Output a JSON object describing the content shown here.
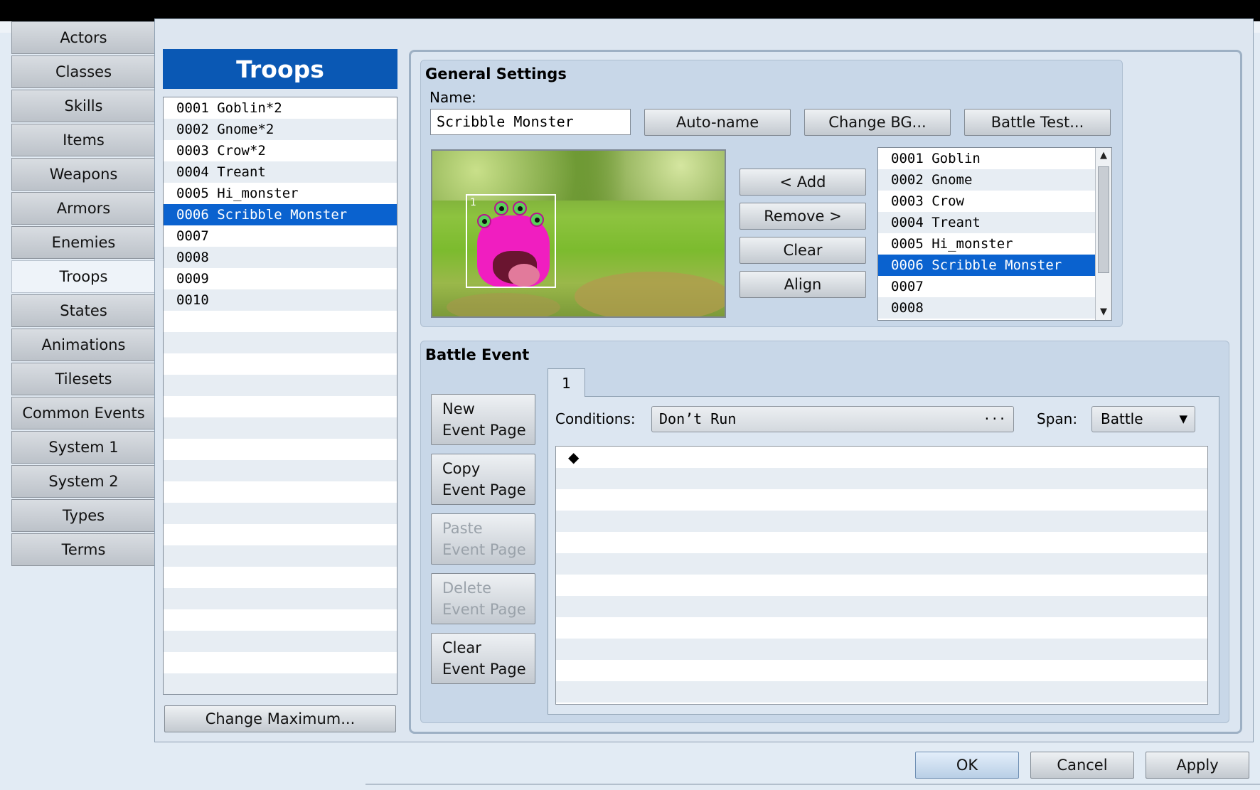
{
  "sidebar": {
    "tabs": [
      "Actors",
      "Classes",
      "Skills",
      "Items",
      "Weapons",
      "Armors",
      "Enemies",
      "Troops",
      "States",
      "Animations",
      "Tilesets",
      "Common Events",
      "System 1",
      "System 2",
      "Types",
      "Terms"
    ],
    "active": "Troops"
  },
  "troops": {
    "header": "Troops",
    "items": [
      "0001 Goblin*2",
      "0002 Gnome*2",
      "0003 Crow*2",
      "0004 Treant",
      "0005 Hi_monster",
      "0006 Scribble Monster",
      "0007",
      "0008",
      "0009",
      "0010"
    ],
    "selected_index": 5,
    "change_max_label": "Change Maximum..."
  },
  "general": {
    "title": "General Settings",
    "name_label": "Name:",
    "name_value": "Scribble Monster",
    "auto_name_label": "Auto-name",
    "change_bg_label": "Change BG...",
    "battle_test_label": "Battle Test...",
    "add_label": "< Add",
    "remove_label": "Remove >",
    "clear_label": "Clear",
    "align_label": "Align",
    "enemy_index": "1",
    "enemy_list": [
      "0001 Goblin",
      "0002 Gnome",
      "0003 Crow",
      "0004 Treant",
      "0005 Hi_monster",
      "0006 Scribble Monster",
      "0007",
      "0008"
    ],
    "enemy_selected_index": 5
  },
  "battle_event": {
    "title": "Battle Event",
    "page_tab": "1",
    "buttons": [
      {
        "line1": "New",
        "line2": "Event Page",
        "enabled": true
      },
      {
        "line1": "Copy",
        "line2": "Event Page",
        "enabled": true
      },
      {
        "line1": "Paste",
        "line2": "Event Page",
        "enabled": false
      },
      {
        "line1": "Delete",
        "line2": "Event Page",
        "enabled": false
      },
      {
        "line1": "Clear",
        "line2": "Event Page",
        "enabled": true
      }
    ],
    "conditions_label": "Conditions:",
    "conditions_value": "Don’t Run",
    "span_label": "Span:",
    "span_value": "Battle",
    "command_marker": "◆"
  },
  "dialog": {
    "ok_label": "OK",
    "cancel_label": "Cancel",
    "apply_label": "Apply"
  },
  "colors": {
    "selection": "#0a62cf",
    "header": "#0a58b4"
  }
}
